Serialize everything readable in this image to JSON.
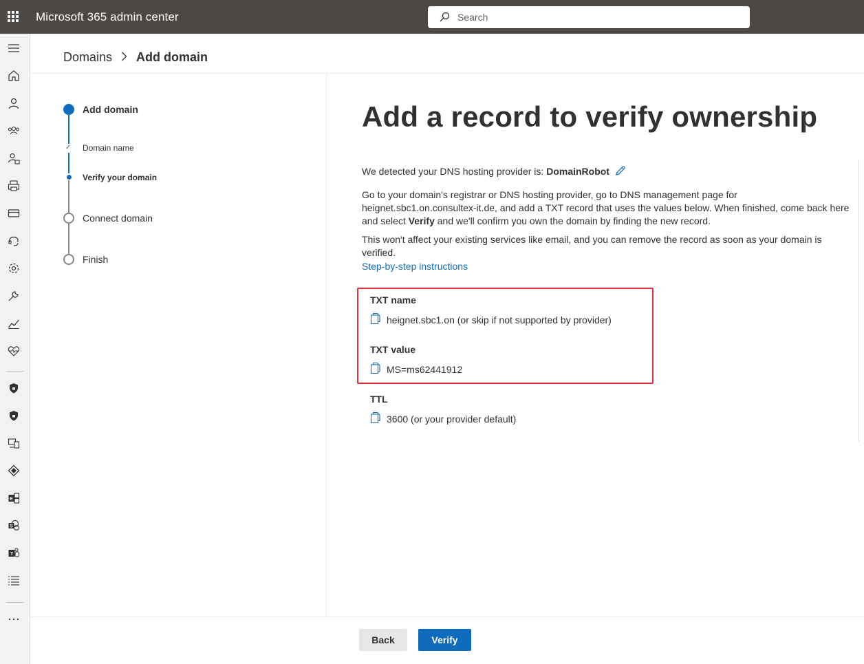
{
  "app": {
    "title": "Microsoft 365 admin center"
  },
  "search": {
    "placeholder": "Search"
  },
  "breadcrumb": {
    "parent": "Domains",
    "current": "Add domain"
  },
  "steps": {
    "main": "Add domain",
    "sub1": "Domain name",
    "sub2": "Verify your domain",
    "step2": "Connect domain",
    "step3": "Finish"
  },
  "content": {
    "title": "Add a record to verify ownership",
    "detect_prefix": "We detected your DNS hosting provider is: ",
    "provider": "DomainRobot",
    "para1_a": "Go to your domain's registrar or DNS hosting provider, go to DNS management page for heignet.sbc1.on.consultex-it.de, and add a TXT record that uses the values below. When finished, come back here and select ",
    "para1_bold": "Verify",
    "para1_b": " and we'll confirm you own the domain by finding the new record.",
    "para2": "This won't affect your existing services like email, and you can remove the record as soon as your domain is verified.",
    "instructions_link": "Step-by-step instructions",
    "txt_name_label": "TXT name",
    "txt_name_value": "heignet.sbc1.on (or skip if not supported by provider)",
    "txt_value_label": "TXT value",
    "txt_value_value": "MS=ms62441912",
    "ttl_label": "TTL",
    "ttl_value": "3600 (or your provider default)"
  },
  "footer": {
    "back": "Back",
    "verify": "Verify"
  },
  "rail_icons": [
    "menu-icon",
    "home-icon",
    "user-icon",
    "groups-icon",
    "roles-icon",
    "printer-icon",
    "billing-icon",
    "support-icon",
    "settings-icon",
    "setup-icon",
    "reports-icon",
    "health-icon",
    "security-icon",
    "compliance-icon",
    "endpoint-icon",
    "azure-ad-icon",
    "exchange-icon",
    "sharepoint-icon",
    "teams-icon",
    "all-admin-centers-icon",
    "more-icon"
  ],
  "colors": {
    "accent": "#0f6cbd",
    "topbar": "#4b4845",
    "highlight": "#e03040"
  }
}
